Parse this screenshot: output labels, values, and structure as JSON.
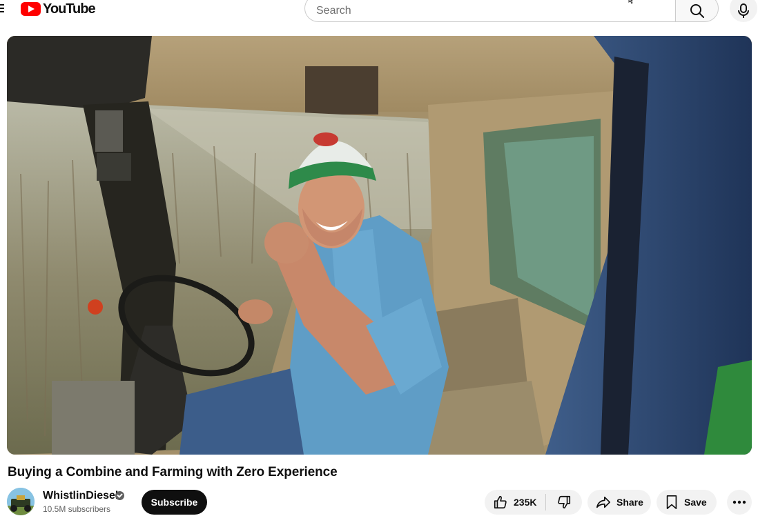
{
  "header": {
    "logo_text": "YouTube",
    "search_placeholder": "Search"
  },
  "video": {
    "title": "Buying a Combine and Farming with Zero Experience"
  },
  "channel": {
    "name": "WhistlinDiesel",
    "subscribers": "10.5M subscribers",
    "subscribe_label": "Subscribe"
  },
  "actions": {
    "like_count": "235K",
    "share_label": "Share",
    "save_label": "Save"
  },
  "icons": {
    "menu": "hamburger-menu-icon",
    "search": "search-icon",
    "mic": "microphone-icon",
    "like": "thumbs-up-icon",
    "dislike": "thumbs-down-icon",
    "share": "share-arrow-icon",
    "save": "bookmark-icon",
    "more": "more-horizontal-icon",
    "verified": "verified-check-icon"
  },
  "colors": {
    "brand_red": "#ff0000",
    "subscribe_bg": "#0f0f0f",
    "pill_bg": "#f2f2f2",
    "secondary_text": "#606060"
  }
}
